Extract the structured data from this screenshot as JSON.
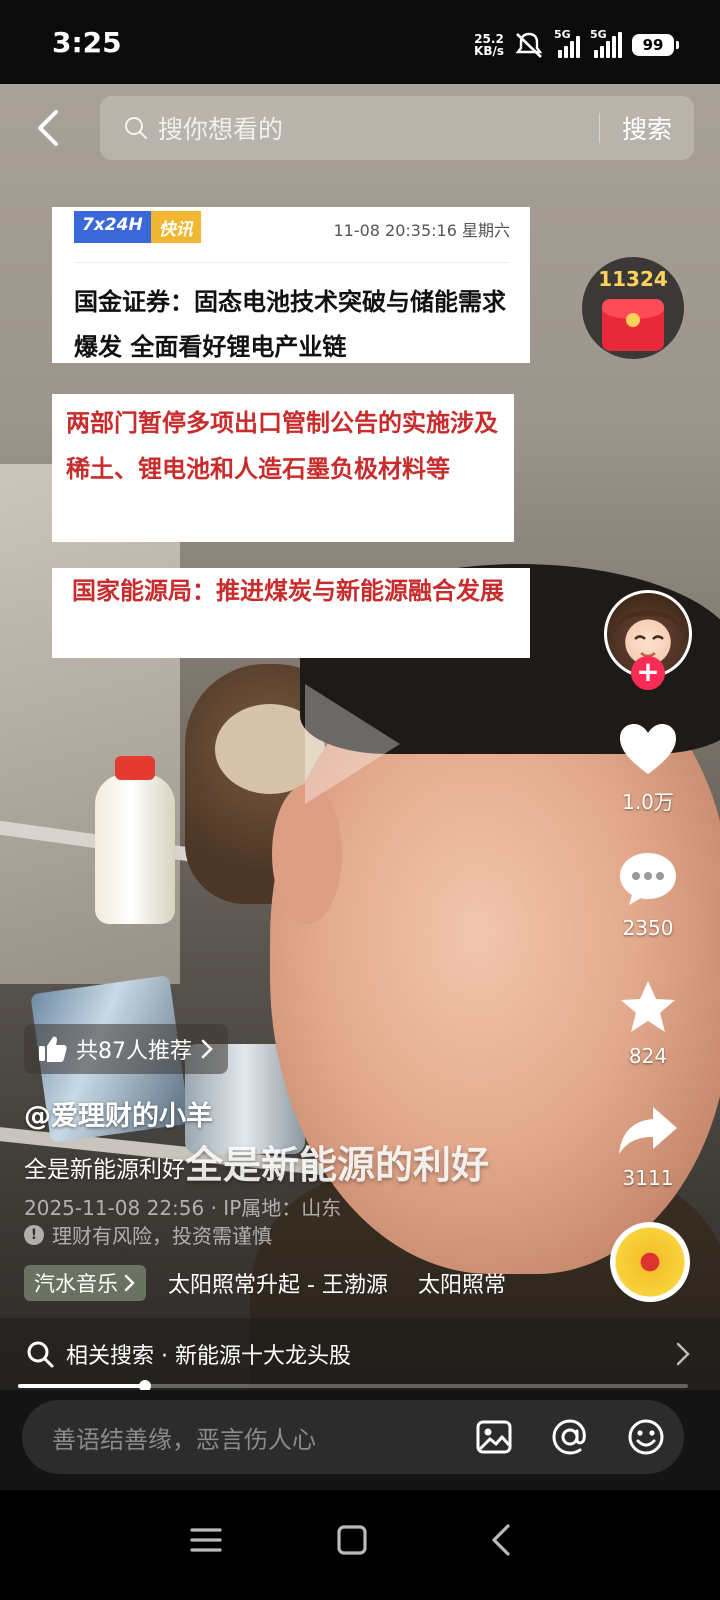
{
  "status_bar": {
    "time": "3:25",
    "net_speed_value": "25.2",
    "net_speed_unit": "KB/s",
    "sim1_label": "5G",
    "sim2_label": "5G",
    "battery": "99"
  },
  "search": {
    "placeholder": "搜你想看的",
    "button_label": "搜索"
  },
  "news": {
    "badge_left": "7x24H",
    "badge_right": "快讯",
    "datetime": "11-08 20:35:16 星期六",
    "headline_1": "国金证券：固态电池技术突破与储能需求爆发 全面看好锂电产业链",
    "headline_2": "两部门暂停多项出口管制公告的实施涉及稀土、锂电池和人造石墨负极材料等",
    "headline_3": "国家能源局：推进煤炭与新能源融合发展"
  },
  "right_rail": {
    "red_packet_count": "11324",
    "like_count": "1.0万",
    "comment_count": "2350",
    "favorite_count": "824",
    "share_count": "3111"
  },
  "video_info": {
    "recommend_label": "共87人推荐",
    "username": "@爱理财的小羊",
    "caption": "全是新能源利好",
    "overlay_title": "全是新能源的利好",
    "meta": "2025-11-08 22:56 · IP属地：山东",
    "risk_notice": "理财有风险，投资需谨慎",
    "music_tag": "汽水音乐",
    "music_title": "太阳照常升起 - 王渤源",
    "music_title_repeat": "太阳照常"
  },
  "related_search": {
    "label": "相关搜索 · 新能源十大龙头股"
  },
  "progress": {
    "fraction": 0.19
  },
  "comment_bar": {
    "placeholder": "善语结善缘，恶言伤人心"
  },
  "colors": {
    "accent_red": "#fe2c55",
    "headline_red": "#c92c2c",
    "badge_blue": "#3a68d8",
    "badge_yellow": "#f1b733"
  }
}
